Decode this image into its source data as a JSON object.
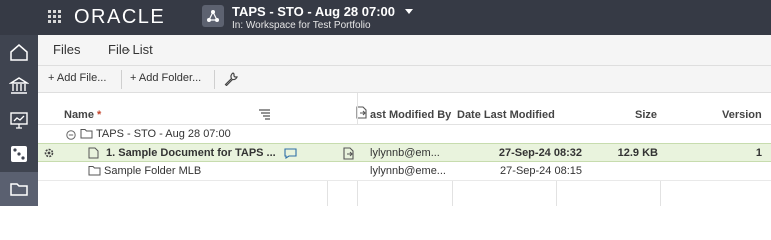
{
  "header": {
    "logo": "ORACLE",
    "workspace_title": "TAPS - STO - Aug 28 07:00",
    "workspace_subtitle": "In: Workspace for Test Portfolio"
  },
  "rail": {
    "items": [
      {
        "name": "home-icon"
      },
      {
        "name": "portfolio-icon"
      },
      {
        "name": "presentation-icon"
      },
      {
        "name": "dice-icon"
      },
      {
        "name": "folder-icon"
      }
    ]
  },
  "breadcrumb": {
    "files": "Files",
    "separator": "›",
    "current": "File List"
  },
  "toolbar": {
    "add_file": "+ Add File...",
    "add_folder": "+ Add Folder..."
  },
  "table": {
    "columns": {
      "name": "Name",
      "required_mark": "*",
      "last_modified_by": "ast Modified By",
      "date_last_modified": "Date Last Modified",
      "size": "Size",
      "version": "Version"
    },
    "rows": [
      {
        "name": "TAPS - STO - Aug 28 07:00",
        "modified_by": "",
        "date": "",
        "size": "",
        "version": ""
      },
      {
        "name": "1. Sample Document for TAPS ...",
        "modified_by": "lylynnb@em...",
        "date": "27-Sep-24 08:32",
        "size": "12.9 KB",
        "version": "1"
      },
      {
        "name": "Sample Folder MLB",
        "modified_by": "lylynnb@eme...",
        "date": "27-Sep-24 08:15",
        "size": "",
        "version": ""
      }
    ]
  },
  "colors": {
    "header_bg": "#363a45",
    "rail_bg": "#3f4450",
    "selected_row": "#e9f3dd"
  }
}
